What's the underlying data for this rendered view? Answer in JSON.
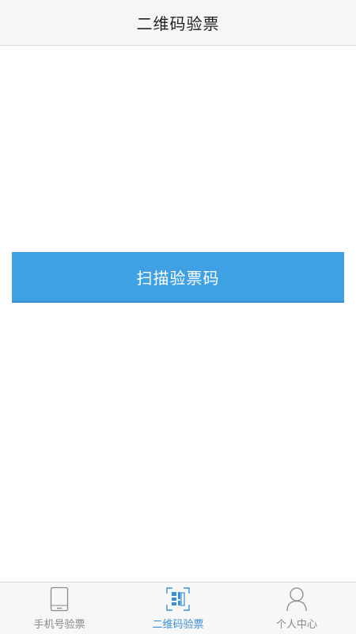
{
  "header": {
    "title": "二维码验票"
  },
  "main": {
    "scan_button_label": "扫描验票码"
  },
  "tabbar": {
    "active_color": "#3a8fd8",
    "inactive_color": "#888888",
    "tabs": [
      {
        "label": "手机号验票",
        "icon": "phone-icon",
        "active": false
      },
      {
        "label": "二维码验票",
        "icon": "qr-code-icon",
        "active": true
      },
      {
        "label": "个人中心",
        "icon": "person-icon",
        "active": false
      }
    ]
  },
  "colors": {
    "button_background": "#3fa1e3",
    "header_background": "#f6f6f6"
  }
}
